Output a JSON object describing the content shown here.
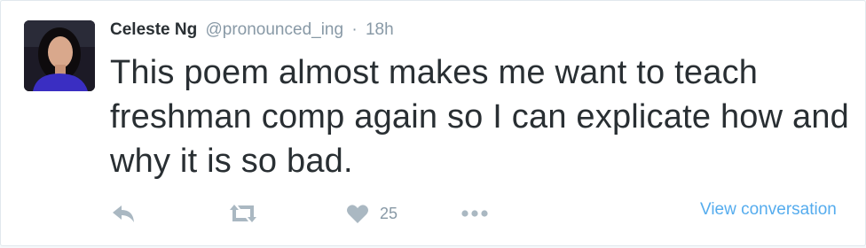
{
  "tweet": {
    "author_name": "Celeste Ng",
    "handle": "@pronounced_ing",
    "separator": "·",
    "time": "18h",
    "text": "This poem almost makes me want to teach freshman comp again so I can explicate how and why it is so bad.",
    "likes": "25",
    "view_conversation_label": "View conversation"
  },
  "icons": {
    "reply": "reply-icon",
    "retweet": "retweet-icon",
    "like": "heart-icon",
    "more": "more-dots-icon"
  },
  "colors": {
    "link": "#55acee",
    "muted": "#8899a6",
    "icon": "#aab8c2",
    "text": "#292f33"
  }
}
